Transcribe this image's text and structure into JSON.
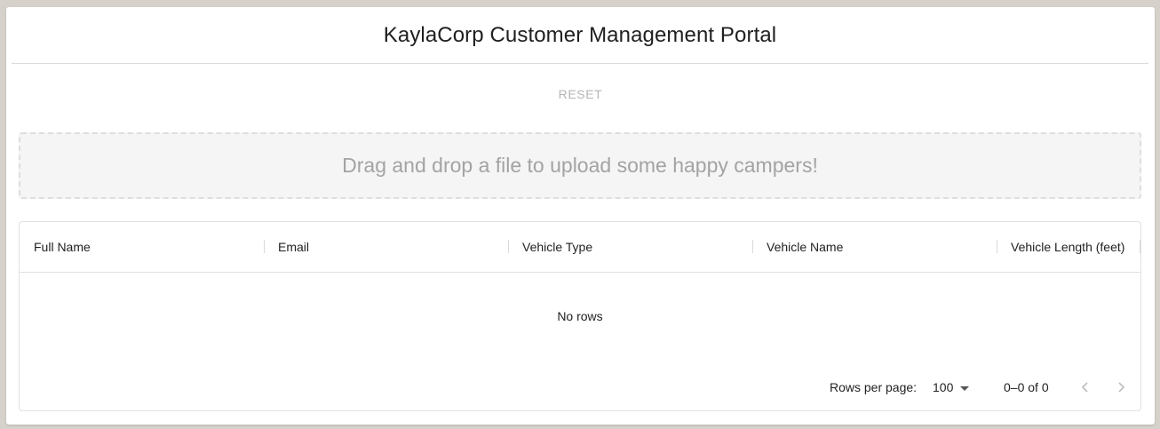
{
  "header": {
    "title": "KaylaCorp Customer Management Portal"
  },
  "toolbar": {
    "reset_label": "RESET"
  },
  "upload": {
    "dropzone_text": "Drag and drop a file to upload some happy campers!"
  },
  "grid": {
    "columns": [
      "Full Name",
      "Email",
      "Vehicle Type",
      "Vehicle Name",
      "Vehicle Length (feet)"
    ],
    "empty_text": "No rows",
    "footer": {
      "rows_per_page_label": "Rows per page:",
      "rows_per_page_value": "100",
      "range_text": "0–0 of 0"
    }
  },
  "icons": {
    "rows_dropdown": "chevron-down-icon",
    "prev_page": "chevron-left-icon",
    "next_page": "chevron-right-icon"
  },
  "colors": {
    "background": "#d6d1cb",
    "card": "#ffffff",
    "muted_text": "#a3a3a3",
    "border": "#e0e0e0"
  }
}
